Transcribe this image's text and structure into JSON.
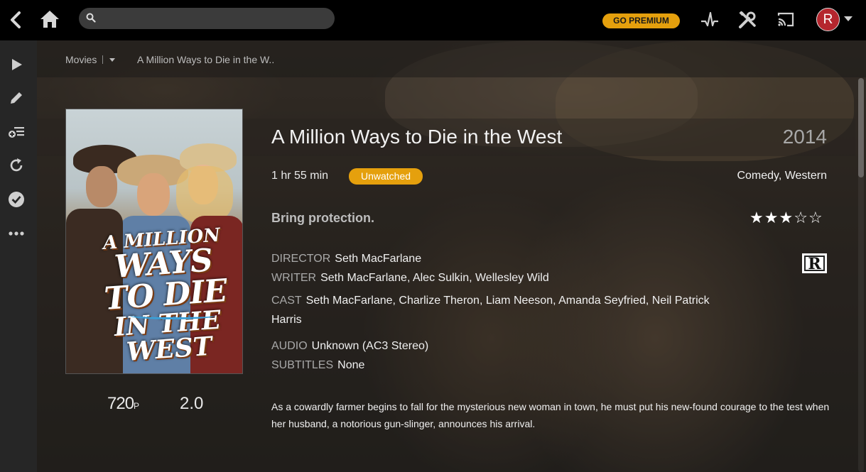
{
  "search": {
    "placeholder": ""
  },
  "header": {
    "premium_label": "GO PREMIUM",
    "avatar_initial": "R"
  },
  "breadcrumb": {
    "section": "Movies",
    "current": "A Million Ways to Die in the W.."
  },
  "movie": {
    "title": "A Million Ways to Die in the West",
    "year": "2014",
    "duration": "1 hr 55 min",
    "watch_status": "Unwatched",
    "genres": "Comedy, Western",
    "tagline": "Bring protection.",
    "star_rating": 3,
    "star_max": 5,
    "content_rating": "R",
    "director_label": "DIRECTOR",
    "director": "Seth MacFarlane",
    "writer_label": "WRITER",
    "writer": "Seth MacFarlane, Alec Sulkin, Wellesley Wild",
    "cast_label": "CAST",
    "cast": "Seth MacFarlane, Charlize Theron, Liam Neeson, Amanda Seyfried, Neil Patrick Harris",
    "audio_label": "AUDIO",
    "audio": "Unknown (AC3 Stereo)",
    "subtitles_label": "SUBTITLES",
    "subtitles": "None",
    "resolution": "720",
    "resolution_suffix": "P",
    "audio_channels": "2.0",
    "summary": "As a cowardly farmer begins to fall for the mysterious new woman in town, he must put his new-found courage to the test when her husband, a notorious gun-slinger, announces his arrival."
  },
  "poster": {
    "title_line1": "A MILLION",
    "title_line2": "WAYS TO DIE",
    "title_line3": "IN THE WEST"
  },
  "icons": {
    "topbar": [
      "back-icon",
      "home-icon",
      "search-icon",
      "activity-icon",
      "tools-icon",
      "cast-icon"
    ],
    "sidebar": [
      "play-icon",
      "edit-icon",
      "add-to-playlist-icon",
      "refresh-icon",
      "mark-watched-icon",
      "more-icon"
    ]
  },
  "colors": {
    "accent": "#e5a00d",
    "avatar": "#b5262e",
    "topbar": "#000000",
    "sidebar": "#262626"
  }
}
